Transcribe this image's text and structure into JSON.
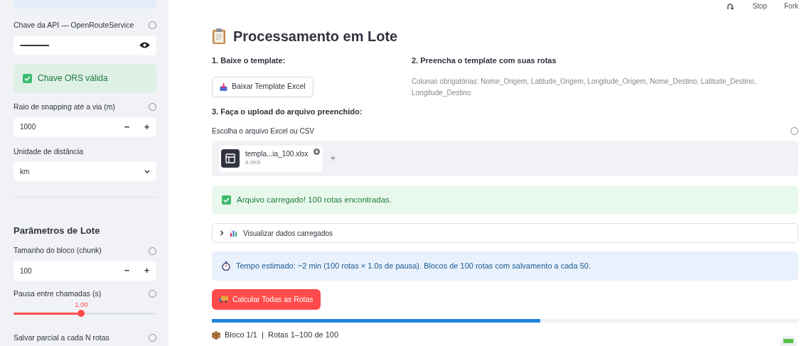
{
  "toolbar": {
    "actions": [
      "Stop",
      "Fork"
    ]
  },
  "sidebar": {
    "api_key": {
      "label": "Chave da API — OpenRouteService",
      "value": "••••••••••••••••••••••••••••••••••••••••••"
    },
    "key_status": "Chave ORS válida",
    "snapping": {
      "label": "Raio de snapping até a via (m)",
      "value": "1000",
      "minus": "−",
      "plus": "+"
    },
    "unit": {
      "label": "Unidade de distância",
      "value": "km"
    },
    "batch_heading": "Parâmetros de Lote",
    "chunk": {
      "label": "Tamanho do bloco (chunk)",
      "value": "100",
      "minus": "−",
      "plus": "+"
    },
    "pause": {
      "label": "Pausa entre chamadas (s)",
      "reading": "1.00",
      "level": 0.475
    },
    "save_every": {
      "label": "Salvar parcial a cada N rotas"
    }
  },
  "main": {
    "title": "Processamento em Lote",
    "step1": {
      "heading": "1. Baixe o template:",
      "button": "Baixar Template Excel"
    },
    "step2": {
      "heading": "2. Preencha o template com suas rotas",
      "note": "Colunas obrigatórias: Nome_Origem, Latitude_Origem, Longitude_Origem, Nome_Destino, Latitude_Destino, Longitude_Destino"
    },
    "step3": {
      "heading": "3. Faça o upload do arquivo preenchido:",
      "uploader_label": "Escolha o arquivo Excel ou CSV",
      "file": {
        "name": "templa...ia_100.xlsx",
        "size": "8.9KB"
      },
      "add": "+"
    },
    "success": "Arquivo carregado! 100 rotas encontradas.",
    "expander": {
      "label": "Visualizar dados carregados",
      "expanded": false
    },
    "info": "Tempo estimado: ~2 min (100 rotas × 1.0s de pausa). Blocos de 100 rotas com salvamento a cada 50.",
    "run_button": "Calcular Todas as Rotas",
    "progress": {
      "level": 0.56
    },
    "status": "Bloco 1/1  |  Rotas 1–100 de 100"
  }
}
